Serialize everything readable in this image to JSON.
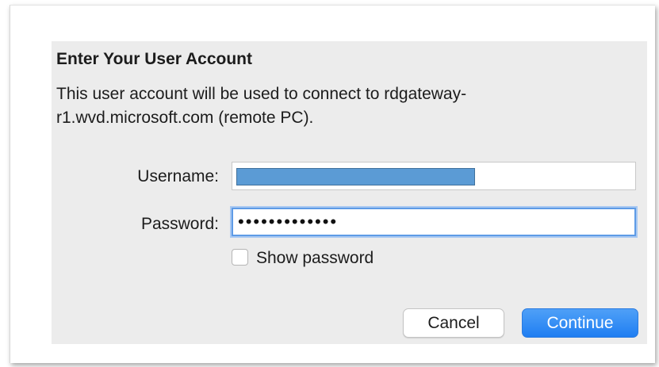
{
  "dialog": {
    "title": "Enter Your User Account",
    "message": "This user account will be used to connect to rdgateway-r1.wvd.microsoft.com (remote PC).",
    "username_label": "Username:",
    "username_value": "",
    "password_label": "Password:",
    "password_value": "•••••••••••••",
    "show_password_label": "Show password",
    "show_password_checked": false,
    "cancel_label": "Cancel",
    "continue_label": "Continue"
  },
  "colors": {
    "redaction_fill": "#5b9bd5",
    "focus_ring": "#5e9be6",
    "primary_button": "#1f7ef2"
  }
}
